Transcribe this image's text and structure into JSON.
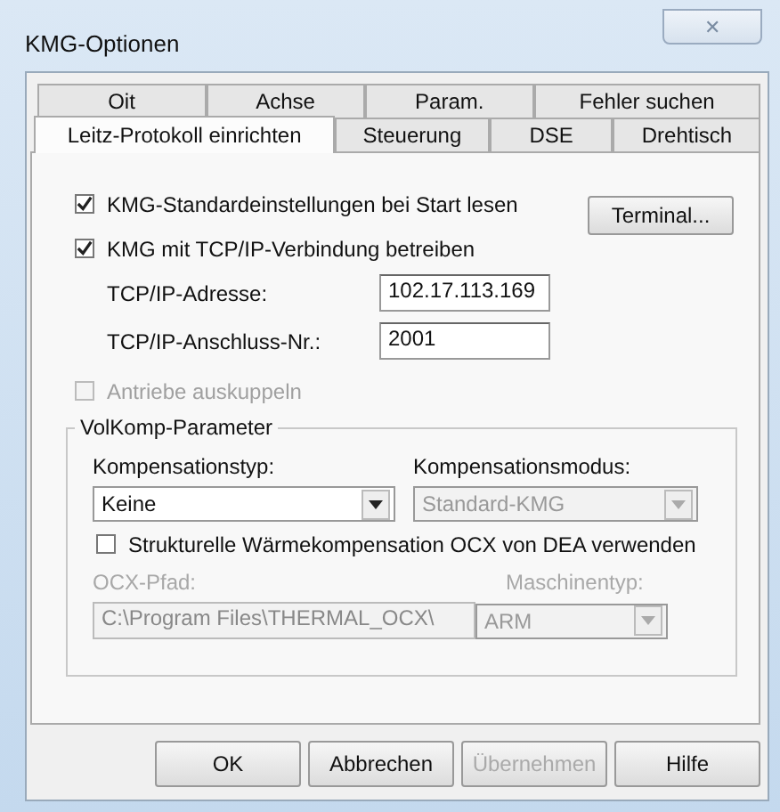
{
  "window": {
    "title": "KMG-Optionen",
    "close_glyph": "✕"
  },
  "tab_rows": [
    [
      {
        "label": "Oit",
        "selected": false
      },
      {
        "label": "Achse",
        "selected": false
      },
      {
        "label": "Param.",
        "selected": false
      },
      {
        "label": "Fehler suchen",
        "selected": false
      }
    ],
    [
      {
        "label": "Leitz-Protokoll einrichten",
        "selected": true
      },
      {
        "label": "Steuerung",
        "selected": false
      },
      {
        "label": "DSE",
        "selected": false
      },
      {
        "label": "Drehtisch",
        "selected": false
      }
    ]
  ],
  "checkboxes": [
    {
      "label": "KMG-Standardeinstellungen bei Start lesen",
      "checked": true,
      "disabled": false
    },
    {
      "label": "KMG mit TCP/IP-Verbindung betreiben",
      "checked": true,
      "disabled": false
    }
  ],
  "terminal_button": "Terminal...",
  "fields": [
    {
      "label": "TCP/IP-Adresse:",
      "value": "102.17.113.169"
    },
    {
      "label": "TCP/IP-Anschluss-Nr.:",
      "value": "2001"
    }
  ],
  "drive_checkbox": {
    "label": "Antriebe auskuppeln",
    "checked": false,
    "disabled": true
  },
  "group": {
    "title": "VolKomp-Parameter",
    "type_label": "Kompensationstyp:",
    "type_value": "Keine",
    "type_disabled": false,
    "mode_label": "Kompensationsmodus:",
    "mode_value": "Standard-KMG",
    "mode_disabled": true,
    "thermal_checkbox": {
      "label": "Strukturelle Wärmekompensation OCX von DEA verwenden",
      "checked": false,
      "disabled": false
    },
    "path_label": "OCX-Pfad:",
    "path_value": "C:\\Program Files\\THERMAL_OCX\\",
    "path_disabled": true,
    "machine_label": "Maschinentyp:",
    "machine_value": "ARM",
    "machine_disabled": true
  },
  "buttons": [
    {
      "label": "OK",
      "disabled": false
    },
    {
      "label": "Abbrechen",
      "disabled": false
    },
    {
      "label": "Übernehmen",
      "disabled": true
    },
    {
      "label": "Hilfe",
      "disabled": false
    }
  ]
}
